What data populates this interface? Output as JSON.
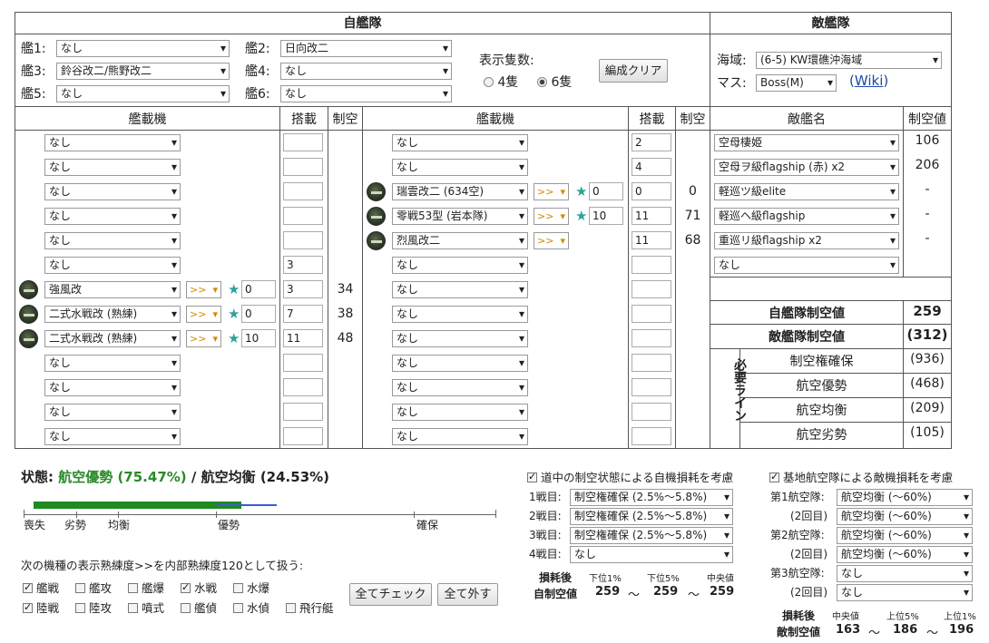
{
  "headers": {
    "own_fleet": "自艦隊",
    "enemy_fleet": "敵艦隊"
  },
  "ships": [
    {
      "label": "艦1:",
      "value": "なし"
    },
    {
      "label": "艦2:",
      "value": "日向改二"
    },
    {
      "label": "艦3:",
      "value": "鈴谷改二/熊野改二"
    },
    {
      "label": "艦4:",
      "value": "なし"
    },
    {
      "label": "艦5:",
      "value": "なし"
    },
    {
      "label": "艦6:",
      "value": "なし"
    }
  ],
  "display": {
    "label": "表示隻数:",
    "opt4": "4隻",
    "opt6": "6隻",
    "selected": "6隻",
    "clear_button": "編成クリア"
  },
  "sea": {
    "label": "海域:",
    "value": "(6-5) KW環礁沖海域",
    "mass_label": "マス:",
    "mass_value": "Boss(M)",
    "wiki_open": "(",
    "wiki_link": "Wiki",
    "wiki_close": ")"
  },
  "columns": {
    "equip": "艦載機",
    "slots": "搭載",
    "air": "制空",
    "enemy_name": "敵艦名",
    "enemy_air": "制空値"
  },
  "left_rows": [
    {
      "equip": "なし",
      "slot": "",
      "air": ""
    },
    {
      "equip": "なし",
      "slot": "",
      "air": ""
    },
    {
      "equip": "なし",
      "slot": "",
      "air": ""
    },
    {
      "equip": "なし",
      "slot": "",
      "air": ""
    },
    {
      "equip": "なし",
      "slot": "",
      "air": ""
    },
    {
      "equip": "なし",
      "slot": "3",
      "air": ""
    },
    {
      "equip": "強風改",
      "slot": "3",
      "air": "34",
      "prof": ">>",
      "star": "0"
    },
    {
      "equip": "二式水戦改 (熟練)",
      "slot": "7",
      "air": "38",
      "prof": ">>",
      "star": "0"
    },
    {
      "equip": "二式水戦改 (熟練)",
      "slot": "11",
      "air": "48",
      "prof": ">>",
      "star": "10"
    },
    {
      "equip": "なし",
      "slot": "",
      "air": ""
    },
    {
      "equip": "なし",
      "slot": "",
      "air": ""
    },
    {
      "equip": "なし",
      "slot": "",
      "air": ""
    },
    {
      "equip": "なし",
      "slot": "",
      "air": ""
    }
  ],
  "right_rows": [
    {
      "equip": "なし",
      "slot": "2",
      "air": ""
    },
    {
      "equip": "なし",
      "slot": "4",
      "air": ""
    },
    {
      "equip": "瑞雲改二 (634空)",
      "slot": "0",
      "air": "0",
      "prof": ">>",
      "star": "0"
    },
    {
      "equip": "零戦53型 (岩本隊)",
      "slot": "11",
      "air": "71",
      "prof": ">>",
      "star": "10"
    },
    {
      "equip": "烈風改二",
      "slot": "11",
      "air": "68",
      "prof": ">>"
    },
    {
      "equip": "なし",
      "slot": "",
      "air": ""
    },
    {
      "equip": "なし",
      "slot": "",
      "air": ""
    },
    {
      "equip": "なし",
      "slot": "",
      "air": ""
    },
    {
      "equip": "なし",
      "slot": "",
      "air": ""
    },
    {
      "equip": "なし",
      "slot": "",
      "air": ""
    },
    {
      "equip": "なし",
      "slot": "",
      "air": ""
    },
    {
      "equip": "なし",
      "slot": "",
      "air": ""
    },
    {
      "equip": "なし",
      "slot": "",
      "air": ""
    }
  ],
  "enemies": [
    {
      "name": "空母棲姫",
      "air": "106"
    },
    {
      "name": "空母ヲ級flagship (赤) x2",
      "air": "206"
    },
    {
      "name": "軽巡ツ級elite",
      "air": "-"
    },
    {
      "name": "軽巡ヘ級flagship",
      "air": "-"
    },
    {
      "name": "重巡リ級flagship x2",
      "air": "-"
    },
    {
      "name": "なし",
      "air": ""
    }
  ],
  "summary": {
    "own_label": "自艦隊制空値",
    "own_value": "259",
    "enemy_label": "敵艦隊制空値",
    "enemy_value": "(312)"
  },
  "required": {
    "label": "必要ライン",
    "rows": [
      {
        "label": "制空権確保",
        "value": "(936)"
      },
      {
        "label": "航空優勢",
        "value": "(468)"
      },
      {
        "label": "航空均衡",
        "value": "(209)"
      },
      {
        "label": "航空劣勢",
        "value": "(105)"
      }
    ]
  },
  "status": {
    "label": "状態:",
    "primary": "航空優勢 (75.47%)",
    "sep": "/",
    "secondary": "航空均衡 (24.53%)",
    "green_fraction": 0.4,
    "blue_fraction": 0.12,
    "primary_color": "#2a8a2a"
  },
  "scale": {
    "ticks": [
      "喪失",
      "劣勢",
      "均衡",
      "優勢",
      "確保"
    ]
  },
  "proficiency": {
    "text": "次の機種の表示熟練度>>を内部熟練度120として扱う:",
    "boxes": [
      {
        "label": "艦戦",
        "checked": true
      },
      {
        "label": "艦攻",
        "checked": false
      },
      {
        "label": "艦爆",
        "checked": false
      },
      {
        "label": "水戦",
        "checked": true
      },
      {
        "label": "水爆",
        "checked": false
      },
      {
        "label": "陸戦",
        "checked": true
      },
      {
        "label": "陸攻",
        "checked": false
      },
      {
        "label": "噴式",
        "checked": false
      },
      {
        "label": "艦偵",
        "checked": false
      },
      {
        "label": "水偵",
        "checked": false
      },
      {
        "label": "飛行艇",
        "checked": false
      }
    ],
    "check_all": "全てチェック",
    "uncheck_all": "全て外す"
  },
  "battle": {
    "checkbox": "道中の制空状態による自機損耗を考慮",
    "checked": true,
    "rows": [
      {
        "label": "1戦目:",
        "value": "制空権確保 (2.5%～5.8%)"
      },
      {
        "label": "2戦目:",
        "value": "制空権確保 (2.5%～5.8%)"
      },
      {
        "label": "3戦目:",
        "value": "制空権確保 (2.5%～5.8%)"
      },
      {
        "label": "4戦目:",
        "value": "なし"
      }
    ],
    "loss_label1": "損耗後",
    "loss_label2": "自制空値",
    "h1": "下位1%",
    "h2": "下位5%",
    "h3": "中央値",
    "v1": "259",
    "v2": "259",
    "v3": "259",
    "tilde": "～"
  },
  "base": {
    "checkbox": "基地航空隊による敵機損耗を考慮",
    "checked": true,
    "rows": [
      {
        "label": "第1航空隊:",
        "value": "航空均衡 (～60%)"
      },
      {
        "label": "(2回目)",
        "value": "航空均衡 (～60%)"
      },
      {
        "label": "第2航空隊:",
        "value": "航空均衡 (～60%)"
      },
      {
        "label": "(2回目)",
        "value": "航空均衡 (～60%)"
      },
      {
        "label": "第3航空隊:",
        "value": "なし"
      },
      {
        "label": "(2回目)",
        "value": "なし"
      }
    ],
    "loss_label1": "損耗後",
    "loss_label2": "敵制空値",
    "h1": "中央値",
    "h2": "上位5%",
    "h3": "上位1%",
    "v1": "163",
    "v2": "186",
    "v3": "196",
    "tilde": "～"
  }
}
